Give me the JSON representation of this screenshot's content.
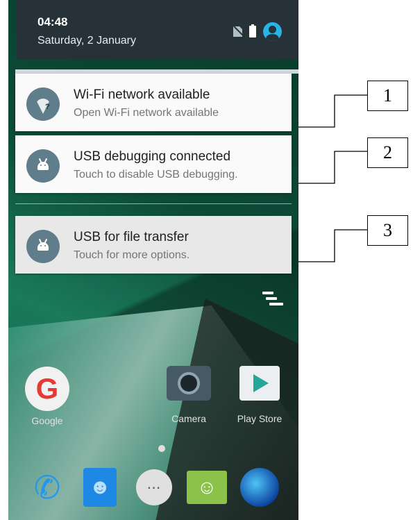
{
  "status_bar": {
    "time": "04:48",
    "date": "Saturday, 2 January",
    "icons": [
      "no-sim-icon",
      "battery-icon",
      "user-avatar-icon"
    ]
  },
  "notifications": [
    {
      "icon": "wifi-question-icon",
      "title": "Wi-Fi network available",
      "subtitle": "Open Wi-Fi network available"
    },
    {
      "icon": "android-debug-icon",
      "title": "USB debugging connected",
      "subtitle": "Touch to disable USB debugging."
    },
    {
      "icon": "android-debug-icon",
      "title": "USB for file transfer",
      "subtitle": "Touch for more options."
    }
  ],
  "clear_all_icon": "clear-all-icon",
  "home_apps": [
    {
      "label": "Google",
      "icon": "google-icon"
    },
    {
      "label": "Camera",
      "icon": "camera-icon"
    },
    {
      "label": "Play Store",
      "icon": "play-store-icon"
    }
  ],
  "dock": [
    "phone-icon",
    "contacts-icon",
    "app-drawer-icon",
    "messaging-icon",
    "browser-icon"
  ],
  "callouts": [
    "1",
    "2",
    "3"
  ],
  "colors": {
    "status_bar_bg": "#263238",
    "notification_icon_bg": "#607d8b",
    "accent_blue": "#27b4e6"
  }
}
